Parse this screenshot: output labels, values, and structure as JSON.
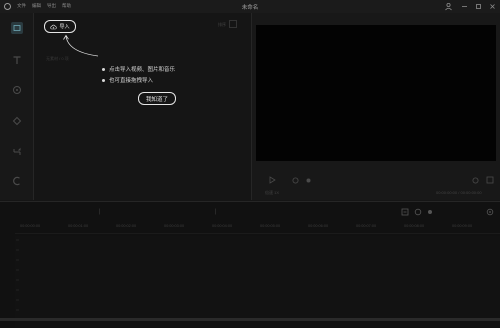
{
  "window": {
    "title": "未命名",
    "menu": [
      "文件",
      "编辑",
      "导出",
      "帮助"
    ]
  },
  "media_panel": {
    "import_label": "导入",
    "faint_hint": "无素材 / 0 项",
    "sort_label": "排序",
    "tips": [
      "点击导入视频、图片和音乐",
      "也可直接拖拽导入"
    ],
    "got_it_label": "我知道了"
  },
  "player": {
    "speed": "1X",
    "time_left": "倍速   1X",
    "time_right": "00:00:00:00 / 00:00:00:00"
  },
  "timeline": {
    "ticks": [
      "00:00:00:00",
      "00:00:01:00",
      "00:00:02:00",
      "00:00:03:00",
      "00:00:04:00",
      "00:00:05:00",
      "00:00:06:00",
      "00:00:07:00",
      "00:00:08:00",
      "00:00:09:00"
    ]
  },
  "icons": {
    "logo": "logo-icon",
    "user": "user-icon",
    "minimize": "minimize-icon",
    "restore": "restore-icon",
    "close": "close-icon"
  },
  "colors": {
    "background": "#151515",
    "player_screen": "#030303",
    "accent_tool": "#6ea8b6",
    "outline": "#e6e6e6"
  }
}
